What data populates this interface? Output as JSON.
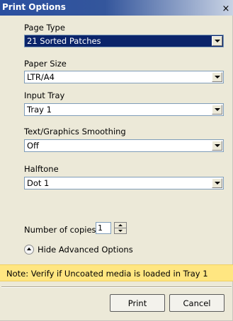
{
  "window": {
    "title": "Print Options",
    "close_glyph": "×"
  },
  "fields": [
    {
      "label": "Page Type",
      "value": "21 Sorted Patches",
      "selected": true
    },
    {
      "label": "Paper Size",
      "value": "LTR/A4"
    },
    {
      "label": "Input Tray",
      "value": "Tray 1"
    },
    {
      "label": "Text/Graphics Smoothing",
      "value": "Off"
    },
    {
      "label": "Halftone",
      "value": "Dot 1"
    }
  ],
  "copies": {
    "label": "Number of copies:",
    "value": "1"
  },
  "advanced": {
    "label": "Hide Advanced Options"
  },
  "note": {
    "text": "Note: Verify if Uncoated media is loaded in Tray 1"
  },
  "buttons": {
    "print": "Print",
    "cancel": "Cancel"
  },
  "colors": {
    "selection": "#0b246a",
    "note_background": "#ffe681",
    "dialog_background": "#ece9d8"
  }
}
